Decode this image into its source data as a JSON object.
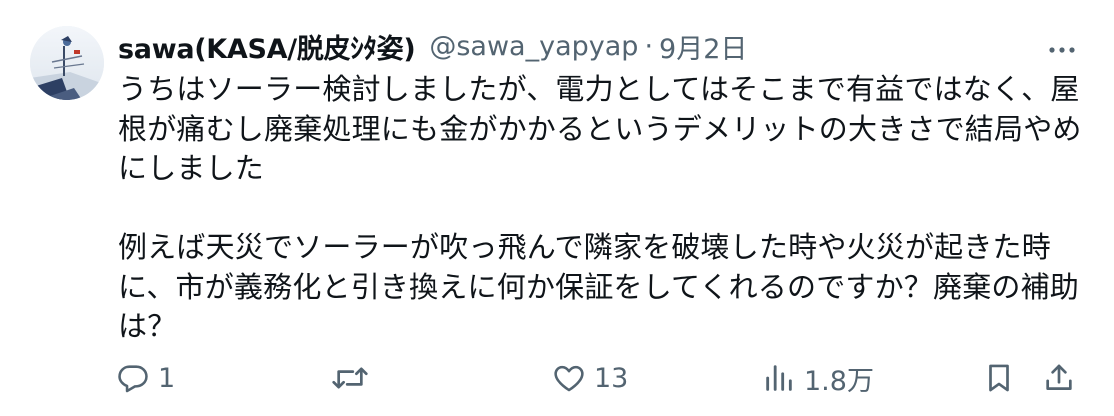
{
  "tweet": {
    "display_name": "sawa(KASA/脱皮ｼﾀ姿)",
    "handle": "@sawa_yapyap",
    "separator": "·",
    "date": "9月2日",
    "paragraphs": [
      "うちはソーラー検討しましたが、電力としてはそこまで有益ではなく、屋根が痛むし廃棄処理にも金がかかるというデメリットの大きさで結局やめにしました",
      "例えば天災でソーラーが吹っ飛んで隣家を破壊した時や火災が起きた時に、市が義務化と引き換えに何か保証をしてくれるのですか？廃棄の補助は？"
    ]
  },
  "actions": {
    "reply_count": "1",
    "retweet_count": "",
    "like_count": "13",
    "views_count": "1.8万"
  },
  "icons": {
    "more": "more-horizontal-icon",
    "reply": "reply-bubble-icon",
    "retweet": "retweet-arrows-icon",
    "like": "heart-icon",
    "views": "analytics-bars-icon",
    "bookmark": "bookmark-icon",
    "share": "share-upload-icon"
  },
  "colors": {
    "text": "#0f1419",
    "muted": "#536471",
    "background": "#ffffff"
  }
}
